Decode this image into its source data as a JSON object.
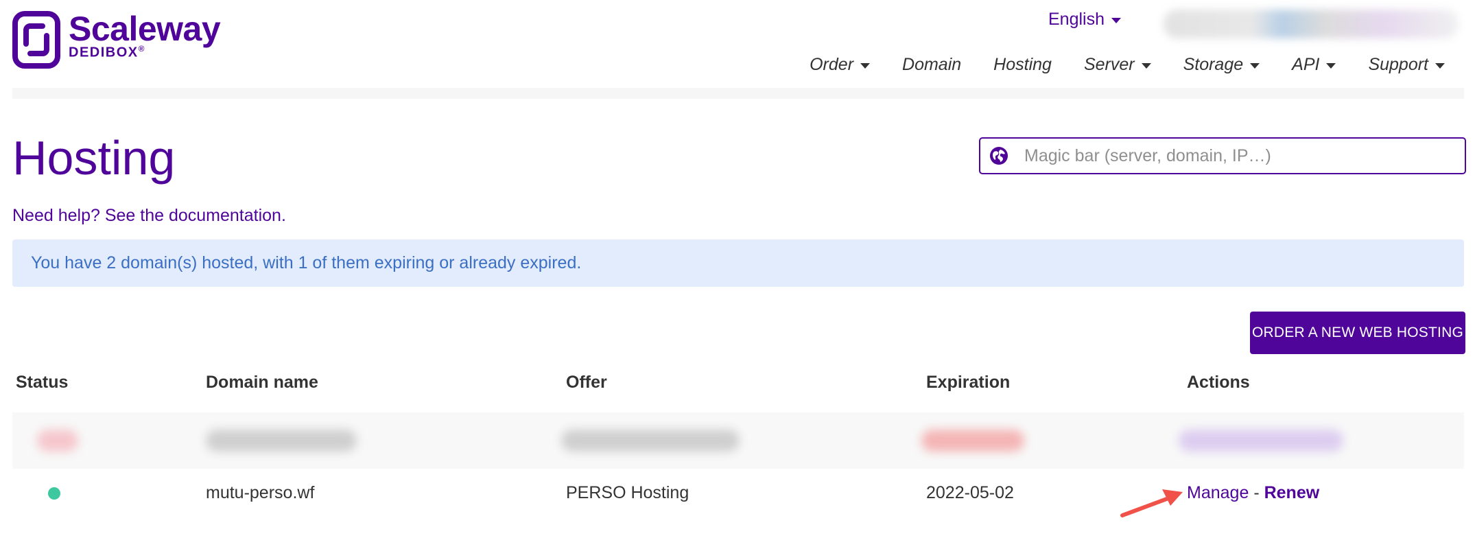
{
  "brand": {
    "name": "Scaleway",
    "subname": "DEDIBOX",
    "trademark": "®",
    "color": "#4f0599"
  },
  "header": {
    "language": "English",
    "nav": [
      {
        "label": "Order",
        "dropdown": true
      },
      {
        "label": "Domain",
        "dropdown": false
      },
      {
        "label": "Hosting",
        "dropdown": false
      },
      {
        "label": "Server",
        "dropdown": true
      },
      {
        "label": "Storage",
        "dropdown": true
      },
      {
        "label": "API",
        "dropdown": true
      },
      {
        "label": "Support",
        "dropdown": true
      }
    ]
  },
  "page": {
    "title": "Hosting",
    "help_text": "Need help? See the documentation.",
    "alert_text": "You have 2 domain(s) hosted, with 1 of them expiring or already expired.",
    "order_button": "ORDER A NEW WEB HOSTING"
  },
  "search": {
    "placeholder": "Magic bar (server, domain, IP…)",
    "value": ""
  },
  "table": {
    "headers": [
      "Status",
      "Domain name",
      "Offer",
      "Expiration",
      "Actions"
    ],
    "rows": [
      {
        "status_color": "#3dc8a0",
        "domain": "mutu-perso.wf",
        "offer": "PERSO Hosting",
        "expiration": "2022-05-02",
        "manage_label": "Manage",
        "separator": "-",
        "renew_label": "Renew"
      }
    ]
  },
  "colors": {
    "alert_bg": "#e3ecfd",
    "alert_text": "#3a6fc4",
    "annotation_arrow": "#f0524a"
  }
}
